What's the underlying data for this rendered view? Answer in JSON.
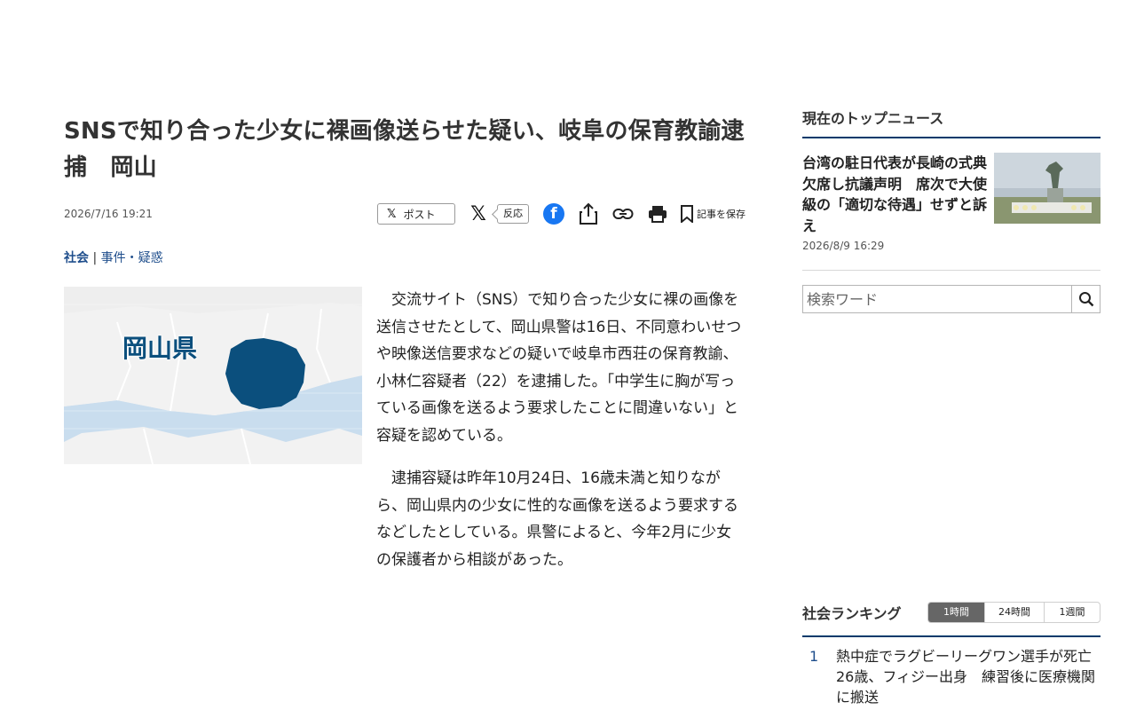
{
  "article": {
    "title": "SNSで知り合った少女に裸画像送らせた疑い、岐阜の保育教諭逮捕　岡山",
    "date": "2026/7/16 19:21",
    "share": {
      "post_label": "ポスト",
      "react_label": "反応",
      "save_label": "記事を保存"
    },
    "category_main": "社会",
    "category_sep": "|",
    "category_sub": "事件・疑惑",
    "photo_label": "岡山県",
    "paragraphs": [
      "交流サイト（SNS）で知り合った少女に裸の画像を送信させたとして、岡山県警は16日、不同意わいせつや映像送信要求などの疑いで岐阜市西荘の保育教諭、小林仁容疑者（22）を逮捕した。「中学生に胸が写っている画像を送るよう要求したことに間違いない」と容疑を認めている。",
      "逮捕容疑は昨年10月24日、16歳未満と知りながら、岡山県内の少女に性的な画像を送るよう要求するなどしたとしている。県警によると、今年2月に少女の保護者から相談があった。"
    ]
  },
  "sidebar": {
    "top_news_heading": "現在のトップニュース",
    "top_news": {
      "headline": "台湾の駐日代表が長崎の式典欠席し抗議声明　席次で大使級の「適切な待遇」せずと訴え",
      "date": "2026/8/9 16:29"
    },
    "search": {
      "placeholder": "検索ワード"
    },
    "ranking": {
      "heading": "社会ランキング",
      "tabs": [
        "1時間",
        "24時間",
        "1週間"
      ],
      "active_tab": 0,
      "items": [
        {
          "rank": "1",
          "text": "熱中症でラグビーリーグワン選手が死亡　26歳、フィジー出身　練習後に医療機関に搬送"
        }
      ]
    }
  },
  "colors": {
    "accent_navy": "#003a6b",
    "link_blue": "#1f4e8c",
    "map_region": "#0b4f7d",
    "facebook": "#1877f2"
  }
}
